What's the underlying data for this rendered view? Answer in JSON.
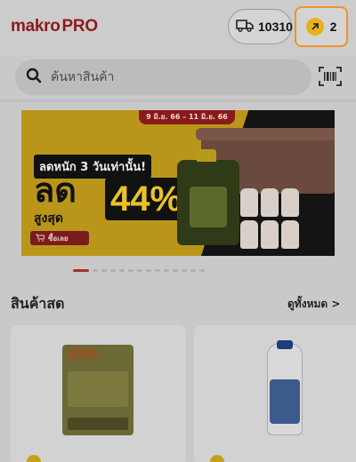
{
  "header": {
    "logo_main": "makro",
    "logo_suffix": "PRO",
    "delivery_count": "10310",
    "coins_count": "2"
  },
  "search": {
    "placeholder": "ค้นหาสินค้า"
  },
  "banner": {
    "date_range": "9 มิ.ย. 66 – 11 มิ.ย. 66",
    "promo_line": "ลดหนัก 3 วันเท่านั้น!",
    "promo_big": "ลด",
    "promo_sub": "สูงสุด",
    "promo_percent": "44%",
    "buy_label": "ซื้อเลย"
  },
  "carousel": {
    "total_dots": 14,
    "active_index": 0
  },
  "section": {
    "title": "สินค้าสด",
    "see_all": "ดูทั้งหมด >"
  },
  "colors": {
    "brand_red": "#8e1a1f",
    "coin_gold": "#e8b21c",
    "highlight_orange": "#f0932a"
  }
}
